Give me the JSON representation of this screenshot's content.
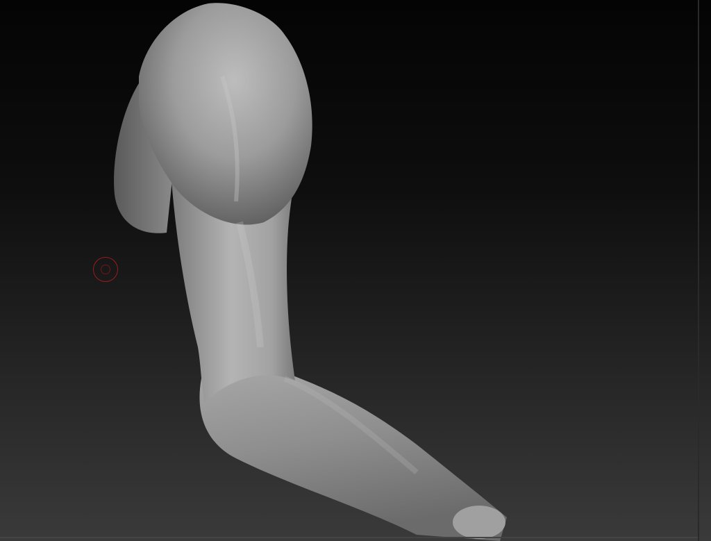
{
  "viewport": {
    "name": "3d-sculpt-canvas",
    "model": "arm-sculpt",
    "background_top_color": "#040404",
    "background_bottom_color": "#3a3a3a",
    "model_color": "#9a9a9a"
  },
  "cursor": {
    "icon": "brush-cursor-icon",
    "color": "#9b1b1b"
  }
}
